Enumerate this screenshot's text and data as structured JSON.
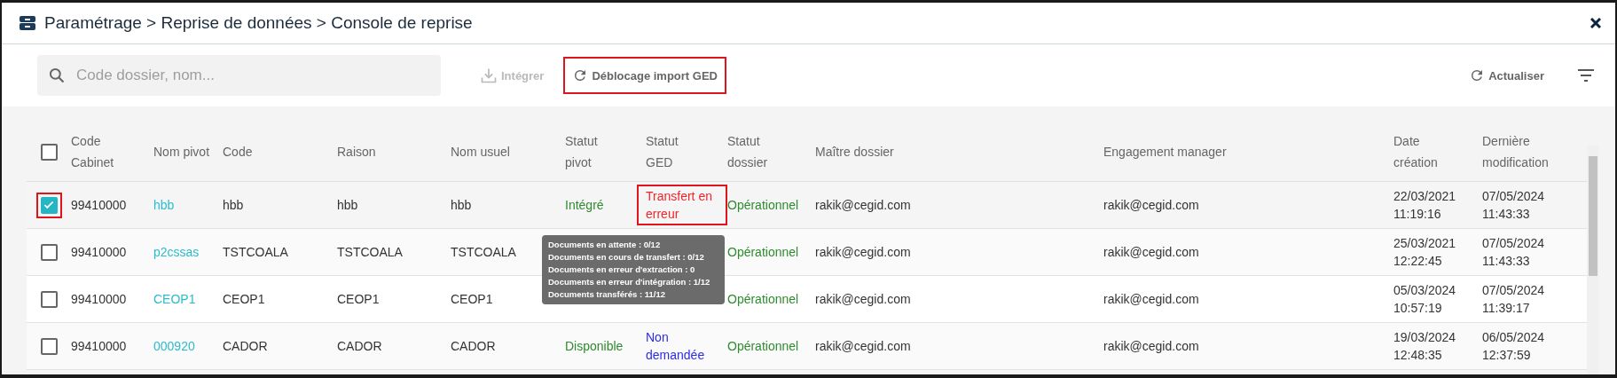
{
  "window": {
    "title": "Paramétrage > Reprise de données > Console de reprise"
  },
  "toolbar": {
    "search": {
      "placeholder": "Code dossier, nom..."
    },
    "buttons": [
      {
        "label": "Intégrer",
        "kind": "import",
        "disabled": true,
        "highlighted": false
      },
      {
        "label": "Déblocage import GED",
        "kind": "refresh",
        "disabled": false,
        "highlighted": true
      }
    ],
    "refresh": {
      "label": "Actualiser"
    }
  },
  "table": {
    "select_all": {
      "checked": false
    },
    "columns": [
      "Code Cabinet",
      "Nom pivot",
      "Code",
      "Raison",
      "Nom usuel",
      "Statut pivot",
      "Statut GED",
      "Statut dossier",
      "Maître dossier",
      "Engagement manager",
      "Date création",
      "Dernière modification"
    ],
    "rows": [
      {
        "checked": true,
        "highlighted": true,
        "code_cabinet": "99410000",
        "nom_pivot": "hbb",
        "code": "hbb",
        "raison": "hbb",
        "nom_usuel": "hbb",
        "statut_pivot": {
          "text": "Intégré",
          "color": "#2e8b2e"
        },
        "statut_ged": {
          "text": "Transfert en erreur",
          "color": "#f0262c",
          "highlighted": true
        },
        "statut_dossier": {
          "text": "Opérationnel",
          "color": "#2e8b2e"
        },
        "maitre": "rakik@cegid.com",
        "engagement": "rakik@cegid.com",
        "date_creation": [
          "22/03/2021",
          "11:19:16"
        ],
        "derniere_modification": [
          "07/05/2024",
          "11:43:33"
        ]
      },
      {
        "checked": false,
        "highlighted": false,
        "code_cabinet": "99410000",
        "nom_pivot": "p2cssas",
        "code": "TSTCOALA",
        "raison": "TSTCOALA",
        "nom_usuel": "TSTCOALA",
        "statut_dossier": {
          "text": "Opérationnel",
          "color": "#2e8b2e"
        },
        "maitre": "rakik@cegid.com",
        "engagement": "rakik@cegid.com",
        "date_creation": [
          "25/03/2021",
          "12:22:45"
        ],
        "derniere_modification": [
          "07/05/2024",
          "11:43:33"
        ]
      },
      {
        "checked": false,
        "highlighted": false,
        "code_cabinet": "99410000",
        "nom_pivot": "CEOP1",
        "code": "CEOP1",
        "raison": "CEOP1",
        "nom_usuel": "CEOP1",
        "statut_dossier": {
          "text": "Opérationnel",
          "color": "#2e8b2e"
        },
        "maitre": "rakik@cegid.com",
        "engagement": "rakik@cegid.com",
        "date_creation": [
          "05/03/2024",
          "10:57:19"
        ],
        "derniere_modification": [
          "07/05/2024",
          "11:39:17"
        ]
      },
      {
        "checked": false,
        "highlighted": false,
        "code_cabinet": "99410000",
        "nom_pivot": "000920",
        "code": "CADOR",
        "raison": "CADOR",
        "nom_usuel": "CADOR",
        "statut_pivot": {
          "text": "Disponible",
          "color": "#2e8b2e"
        },
        "statut_ged": {
          "text": "Non demandée",
          "color": "#2b2bf0",
          "highlighted": false
        },
        "statut_dossier": {
          "text": "Opérationnel",
          "color": "#2e8b2e"
        },
        "maitre": "rakik@cegid.com",
        "engagement": "rakik@cegid.com",
        "date_creation": [
          "19/03/2024",
          "12:48:35"
        ],
        "derniere_modification": [
          "06/05/2024",
          "12:37:59"
        ]
      }
    ]
  },
  "tooltip": {
    "lines": [
      "Documents en attente : 0/12",
      "Documents en cours de transfert : 0/12",
      "Documents en erreur d'extraction : 0",
      "Documents en erreur d'intégration : 1/12",
      "Documents transférés : 11/12"
    ]
  }
}
